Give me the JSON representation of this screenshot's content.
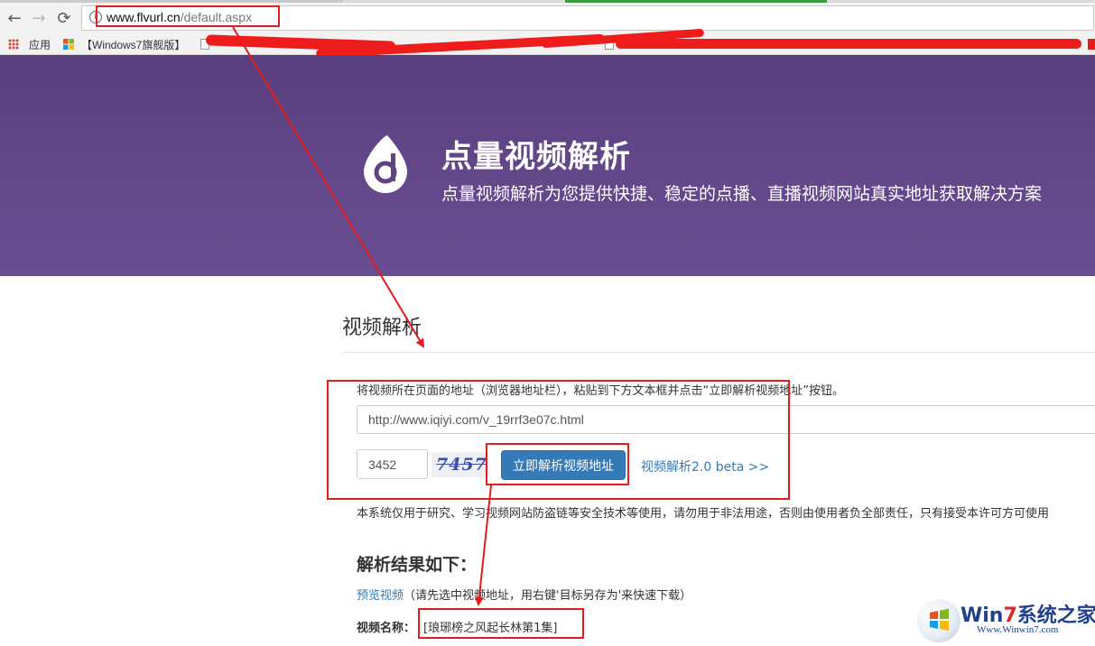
{
  "browser": {
    "nav": {
      "back": "←",
      "forward": "→",
      "reload": "⟳",
      "info": "i"
    },
    "address": {
      "host": "www.flvurl.cn",
      "path": "/default.aspx"
    },
    "bookmarks": {
      "apps": "应用",
      "item1": "【Windows7旗舰版】"
    }
  },
  "hero": {
    "title": "点量视频解析",
    "subtitle": "点量视频解析为您提供快捷、稳定的点播、直播视频网站真实地址获取解决方案"
  },
  "form": {
    "section_title": "视频解析",
    "instruction": "将视频所在页面的地址（浏览器地址栏），粘贴到下方文本框并点击“立即解析视频地址”按钮。",
    "url_value": "http://www.iqiyi.com/v_19rrf3e07c.html",
    "code_value": "3452",
    "captcha_text": "7457",
    "submit_label": "立即解析视频地址",
    "beta_link": "视频解析2.0 beta >>",
    "disclaimer": "本系统仅用于研究、学习视频网站防盗链等安全技术等使用，请勿用于非法用途，否则由使用者负全部责任，只有接受本许可方可使用"
  },
  "result": {
    "heading": "解析结果如下：",
    "preview_link": "预览视频",
    "preview_hint": "（请先选中视频地址，用右键'目标另存为'来快速下载）",
    "name_label": "视频名称：",
    "name_value": "[琅琊榜之风起长林第1集]"
  },
  "watermark": {
    "brand_a": "Win",
    "brand_seven": "7",
    "brand_b": "系统之家",
    "url": "Www.Winwin7.com"
  },
  "colors": {
    "hero": "#5e4385",
    "primary": "#337ab7",
    "annotation": "#e51c1c"
  }
}
